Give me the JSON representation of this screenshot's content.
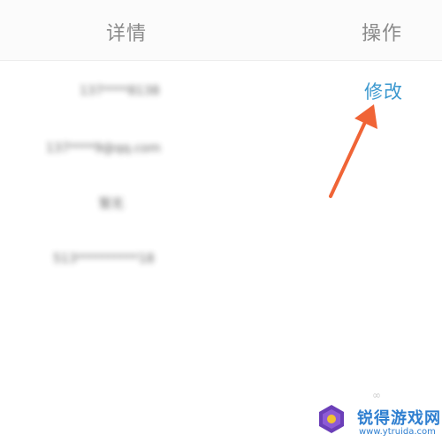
{
  "header": {
    "detail_label": "详情",
    "action_label": "操作"
  },
  "rows": [
    {
      "value": "137****8138",
      "action_label": "修改"
    },
    {
      "value": "137****9@qq.com"
    },
    {
      "value": "暂无"
    },
    {
      "value": "513**********18"
    }
  ],
  "watermark": {
    "title": "锐得游戏网",
    "url": "www.ytruida.com"
  },
  "colors": {
    "accent": "#3b98cf",
    "arrow": "#f06436",
    "header_text": "#8a8a8a"
  }
}
